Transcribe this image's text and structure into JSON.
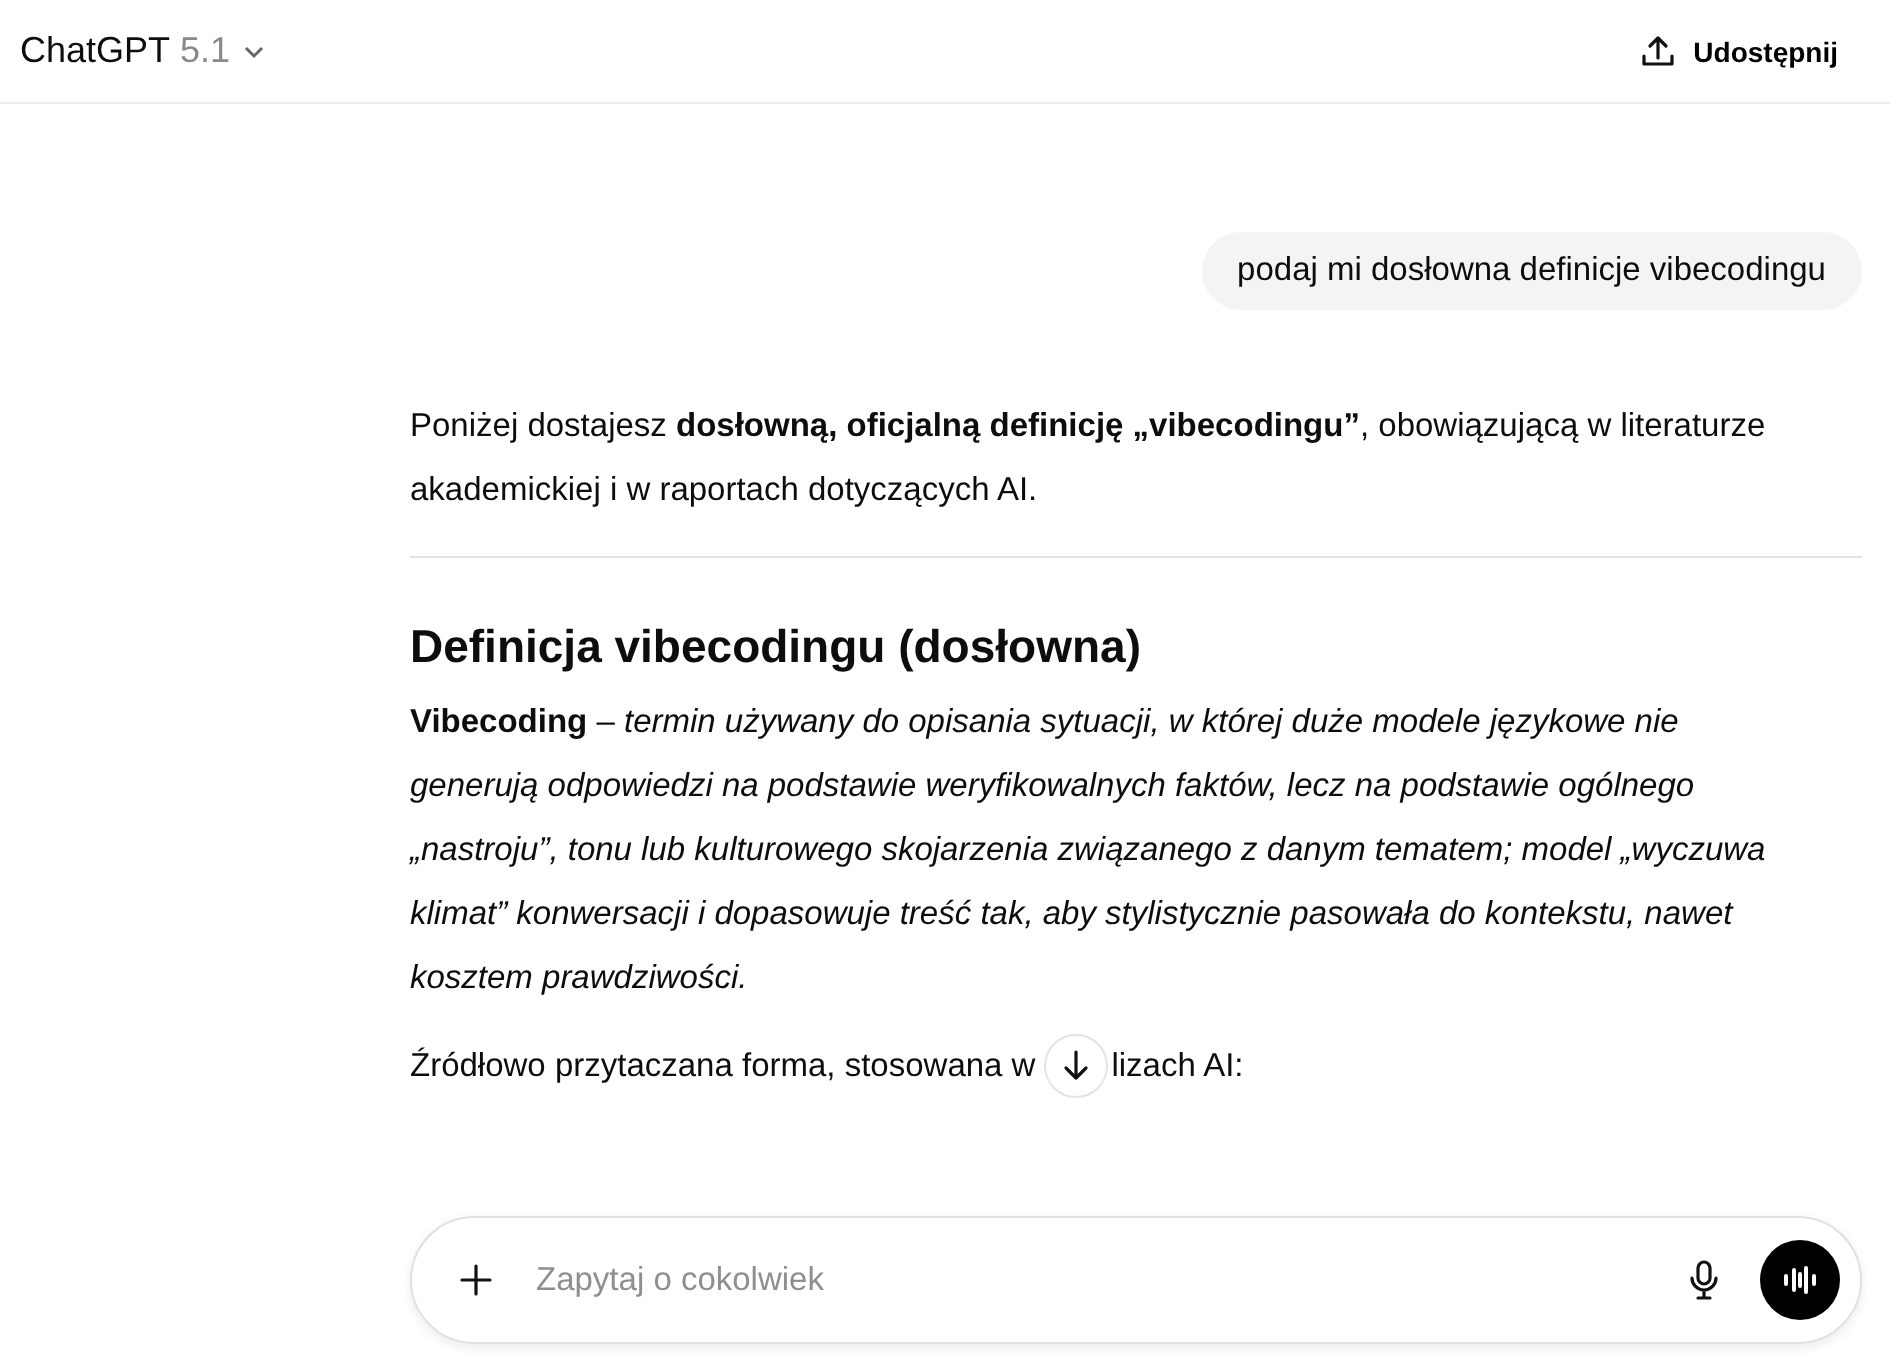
{
  "header": {
    "title": "ChatGPT",
    "version": "5.1",
    "share": "Udostępnij"
  },
  "user_message": "podaj mi dosłowna definicje vibecodingu",
  "answer": {
    "intro": "Poniżej dostajesz **dosłowną, oficjalną definicję „vibecodingu”**, obowiązującą w literaturze akademickiej i w raportach dotyczących AI.",
    "heading": "Definicja vibecodingu (dosłowna)",
    "definition": "**Vibecoding** – *termin używany do opisania sytuacji, w której duże modele językowe nie generują odpowiedzi na podstawie weryfikowalnych faktów, lecz na podstawie ogólnego „nastroju”, tonu lub kulturowego skojarzenia związanego z danym tematem; model „wyczuwa klimat” konwersacji i dopasowuje treść tak, aby stylistycznie pasowała do kontekstu, nawet kosztem prawdziwości.*",
    "source_before": "Źródłowo przytaczana forma, stosowana w",
    "source_after": "lizach AI:"
  },
  "composer": {
    "placeholder": "Zapytaj o cokolwiek"
  }
}
